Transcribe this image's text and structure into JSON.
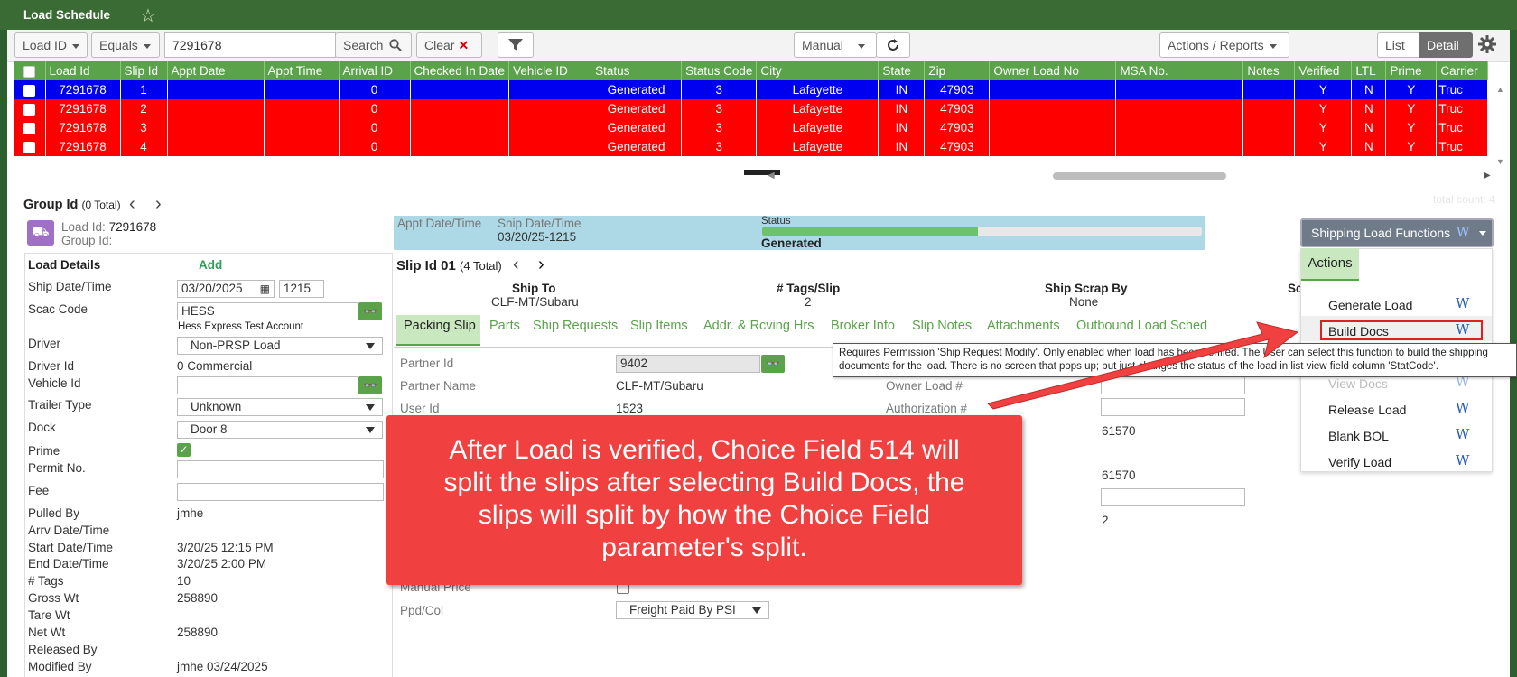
{
  "app": {
    "title": "Load Schedule"
  },
  "toolbar": {
    "filter_field": "Load ID",
    "filter_op": "Equals",
    "search_value": "7291678",
    "search_label": "Search",
    "clear_label": "Clear",
    "mode": "Manual",
    "actions_reports": "Actions / Reports",
    "view_list": "List",
    "view_detail": "Detail"
  },
  "grid": {
    "columns": [
      "Load Id",
      "Slip Id",
      "Appt Date",
      "Appt Time",
      "Arrival ID",
      "Checked In Date",
      "Vehicle ID",
      "Status",
      "Status Code",
      "City",
      "State",
      "Zip",
      "Owner Load No",
      "MSA No.",
      "Notes",
      "Verified",
      "LTL",
      "Prime",
      "Carrier"
    ],
    "rows": [
      {
        "load_id": "7291678",
        "slip_id": "1",
        "appt_date": "",
        "appt_time": "",
        "arrival_id": "0",
        "checked_in": "",
        "vehicle_id": "",
        "status": "Generated",
        "status_code": "3",
        "city": "Lafayette",
        "state": "IN",
        "zip": "47903",
        "owner_load": "",
        "msa": "",
        "notes": "",
        "verified": "Y",
        "ltl": "N",
        "prime": "Y",
        "carrier": "Truc"
      },
      {
        "load_id": "7291678",
        "slip_id": "2",
        "appt_date": "",
        "appt_time": "",
        "arrival_id": "0",
        "checked_in": "",
        "vehicle_id": "",
        "status": "Generated",
        "status_code": "3",
        "city": "Lafayette",
        "state": "IN",
        "zip": "47903",
        "owner_load": "",
        "msa": "",
        "notes": "",
        "verified": "Y",
        "ltl": "N",
        "prime": "Y",
        "carrier": "Truc"
      },
      {
        "load_id": "7291678",
        "slip_id": "3",
        "appt_date": "",
        "appt_time": "",
        "arrival_id": "0",
        "checked_in": "",
        "vehicle_id": "",
        "status": "Generated",
        "status_code": "3",
        "city": "Lafayette",
        "state": "IN",
        "zip": "47903",
        "owner_load": "",
        "msa": "",
        "notes": "",
        "verified": "Y",
        "ltl": "N",
        "prime": "Y",
        "carrier": "Truc"
      },
      {
        "load_id": "7291678",
        "slip_id": "4",
        "appt_date": "",
        "appt_time": "",
        "arrival_id": "0",
        "checked_in": "",
        "vehicle_id": "",
        "status": "Generated",
        "status_code": "3",
        "city": "Lafayette",
        "state": "IN",
        "zip": "47903",
        "owner_load": "",
        "msa": "",
        "notes": "",
        "verified": "Y",
        "ltl": "N",
        "prime": "Y",
        "carrier": "Truc"
      }
    ],
    "total_count": "total count: 4"
  },
  "group": {
    "label": "Group Id",
    "total": "(0 Total)",
    "load_id_label": "Load Id:",
    "load_id_value": "7291678",
    "group_id_label": "Group Id:"
  },
  "load_details": {
    "heading": "Load Details",
    "add_label": "Add",
    "ship_date_label": "Ship Date/Time",
    "ship_date": "03/20/2025",
    "ship_time": "1215",
    "scac_label": "Scac Code",
    "scac_value": "HESS",
    "scac_desc": "Hess Express Test Account",
    "driver_label": "Driver",
    "driver_value": "Non-PRSP Load",
    "driver_id_label": "Driver Id",
    "driver_id_value": "0 Commercial",
    "vehicle_id_label": "Vehicle Id",
    "trailer_type_label": "Trailer Type",
    "trailer_type_value": "Unknown",
    "dock_label": "Dock",
    "dock_value": "Door 8",
    "prime_label": "Prime",
    "permit_label": "Permit No.",
    "fee_label": "Fee",
    "pulled_by_label": "Pulled By",
    "pulled_by_value": "jmhe",
    "arrv_label": "Arrv Date/Time",
    "start_label": "Start Date/Time",
    "start_value": "3/20/25 12:15 PM",
    "end_label": "End Date/Time",
    "end_value": "3/20/25 2:00 PM",
    "tags_label": "# Tags",
    "tags_value": "10",
    "gross_label": "Gross Wt",
    "gross_value": "258890",
    "tare_label": "Tare Wt",
    "net_label": "Net Wt",
    "net_value": "258890",
    "released_label": "Released By",
    "modified_label": "Modified By",
    "modified_value": "jmhe 03/24/2025"
  },
  "status_bar": {
    "appt_label": "Appt Date/Time",
    "ship_label": "Ship Date/Time",
    "ship_value": "03/20/25-1215",
    "status_label": "Status",
    "status_value": "Generated",
    "progress": 0.49
  },
  "slip": {
    "title": "Slip Id 01",
    "total": "(4 Total)",
    "ship_to_label": "Ship To",
    "ship_to_value": "CLF-MT/Subaru",
    "tags_label": "# Tags/Slip",
    "tags_value": "2",
    "scrap_label": "Ship Scrap By",
    "scrap_value": "None",
    "extra_label": "Sc"
  },
  "tabs": [
    "Packing Slip",
    "Parts",
    "Ship Requests",
    "Slip Items",
    "Addr. & Rcving Hrs",
    "Broker Info",
    "Slip Notes",
    "Attachments",
    "Outbound Load Sched"
  ],
  "packing": {
    "partner_id_label": "Partner Id",
    "partner_id_value": "9402",
    "partner_name_label": "Partner Name",
    "partner_name_value": "CLF-MT/Subaru",
    "user_id_label": "User Id",
    "user_id_value": "1523",
    "owner_load_label": "Owner Load #",
    "auth_label": "Authorization #",
    "val_61570_a": "61570",
    "val_61570_b": "61570",
    "val_2": "2",
    "manual_price_label": "Manual Price",
    "ppd_col_label": "Ppd/Col",
    "ppd_col_value": "Freight Paid By PSI"
  },
  "functions": {
    "button_label": "Shipping Load Functions",
    "actions_tab": "Actions",
    "items": [
      "Generate Load",
      "Build Docs",
      "View Docs",
      "Release Load",
      "Blank BOL",
      "Verify Load"
    ],
    "w_glyph": "W"
  },
  "tooltip": "Requires Permission 'Ship Request Modify'. Only enabled when load has been verified. The User can select this function to build the shipping documents for the load. There is no screen that pops up; but just changes the status of the load in list view field column 'StatCode'.",
  "callout": "After Load is verified, Choice Field 514 will split the slips after selecting Build Docs, the slips will split by how the Choice Field parameter's split.",
  "colors": {
    "header_green": "#5aa34a",
    "selected_row": "#0000f0",
    "error_row": "#ff0000",
    "callout": "#f04040",
    "arrow": "#f04040"
  }
}
